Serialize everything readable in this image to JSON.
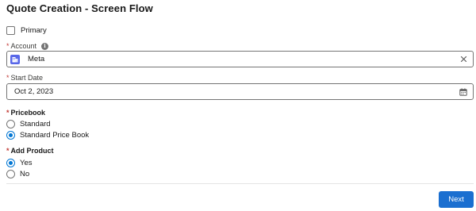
{
  "title": "Quote Creation - Screen Flow",
  "primary": {
    "label": "Primary",
    "checked": false
  },
  "account": {
    "label": "Account",
    "required_marker": "*",
    "info_icon": "info-icon",
    "value": "Meta",
    "icon": "account-icon",
    "clear_icon": "close-icon"
  },
  "start_date": {
    "label": "Start Date",
    "required_marker": "*",
    "value": "Oct 2, 2023",
    "icon": "calendar-icon"
  },
  "pricebook": {
    "label": "Pricebook",
    "required_marker": "*",
    "options": [
      {
        "label": "Standard",
        "selected": false
      },
      {
        "label": "Standard Price Book",
        "selected": true
      }
    ]
  },
  "add_product": {
    "label": "Add Product",
    "required_marker": "*",
    "options": [
      {
        "label": "Yes",
        "selected": true
      },
      {
        "label": "No",
        "selected": false
      }
    ]
  },
  "footer": {
    "next_label": "Next"
  },
  "colors": {
    "accent": "#0176d3",
    "button": "#1b6fd0",
    "required": "#c23934",
    "account_icon": "#5867e8"
  }
}
